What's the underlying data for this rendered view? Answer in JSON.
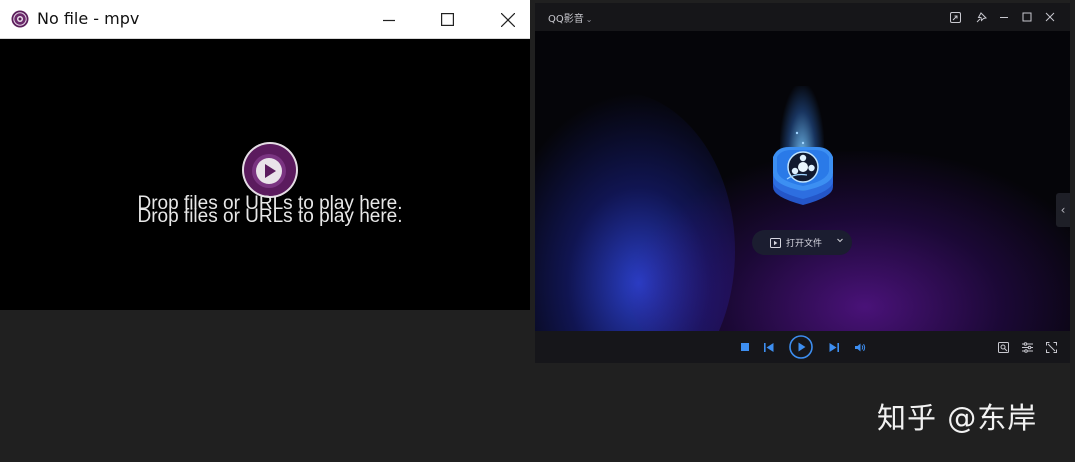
{
  "mpv": {
    "window_title": "No file - mpv",
    "drop_message": "Drop files or URLs to play here.",
    "drop_message_echo": "Drop files or URLs to play here.",
    "icons": {
      "app": "mpv-logo-icon",
      "minimize": "minimize-icon",
      "maximize": "maximize-icon",
      "close": "close-icon",
      "center_logo": "mpv-play-logo-icon"
    }
  },
  "qq": {
    "app_name": "QQ影音",
    "title_caret": "⌄",
    "title_buttons": [
      "mini-mode-icon",
      "pin-icon",
      "minimize-icon",
      "maximize-icon",
      "close-icon"
    ],
    "open_file_label": "打开文件",
    "side_tab_glyph": "‹",
    "controls": {
      "left": [
        "stop-icon",
        "previous-icon",
        "play-icon",
        "next-icon",
        "volume-icon"
      ],
      "right": [
        "screenshot-icon",
        "settings-icon",
        "fullscreen-icon"
      ]
    },
    "colors": {
      "accent": "#3d8ef0",
      "button_bg": "#1b1d30"
    }
  },
  "watermark": {
    "text": "知乎 @东岸"
  }
}
